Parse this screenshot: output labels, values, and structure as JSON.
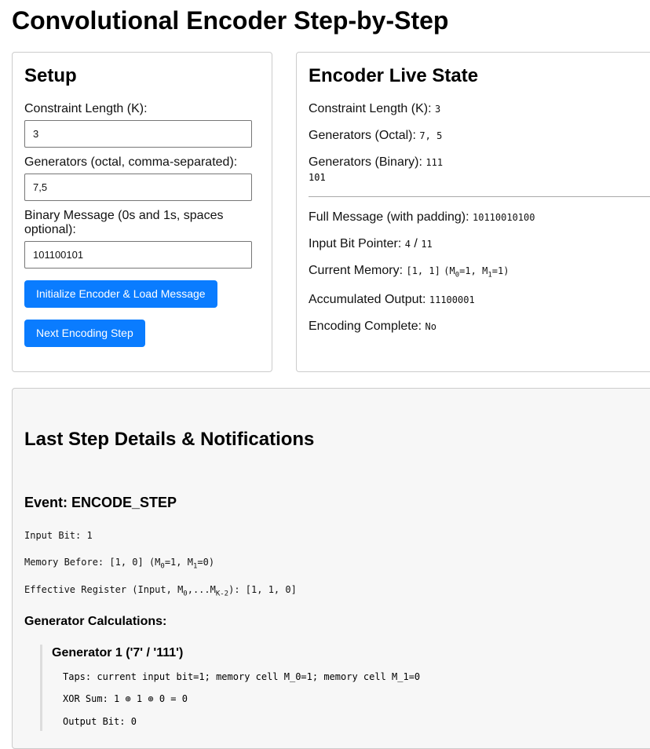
{
  "page": {
    "title": "Convolutional Encoder Step-by-Step"
  },
  "setup": {
    "heading": "Setup",
    "k_label": "Constraint Length (K):",
    "k_value": "3",
    "gen_label": "Generators (octal, comma-separated):",
    "gen_value": "7,5",
    "msg_label": "Binary Message (0s and 1s, spaces optional):",
    "msg_value": "101100101",
    "init_button": "Initialize Encoder & Load Message",
    "next_button": "Next Encoding Step"
  },
  "live": {
    "heading": "Encoder Live State",
    "k_label": "Constraint Length (K):",
    "k_value": "3",
    "gen_octal_label": "Generators (Octal):",
    "gen_octal_value": "7, 5",
    "gen_binary_label": "Generators (Binary):",
    "gen_binary_line1": "111",
    "gen_binary_line2": "101",
    "full_msg_label": "Full Message (with padding):",
    "full_msg_value": "10110010100",
    "pointer_label": "Input Bit Pointer:",
    "pointer_current": "4",
    "pointer_sep": " / ",
    "pointer_total": "11",
    "memory_label": "Current Memory:",
    "memory_value": "[1, 1]",
    "memory_m0": "1",
    "memory_m1": "1",
    "output_label": "Accumulated Output:",
    "output_value": "11100001",
    "complete_label": "Encoding Complete:",
    "complete_value": "No"
  },
  "details": {
    "heading": "Last Step Details & Notifications",
    "event_heading": "Event: ENCODE_STEP",
    "input_bit_text": "Input Bit: 1",
    "memory_before_prefix": "Memory Before: [1, 0] (M",
    "memory_before_m0": "1",
    "memory_before_m1": "0",
    "effective_prefix": "Effective Register (Input, M",
    "effective_value": "[1, 1, 0]",
    "gen_calc_heading": "Generator Calculations:",
    "gen1_heading": "Generator 1 ('7' / '111')",
    "gen1_taps": "Taps: current input bit=1; memory cell M_0=1; memory cell M_1=0",
    "gen1_xor": "XOR Sum: 1 ⊕ 1 ⊕ 0 = 0",
    "gen1_output": "Output Bit: 0"
  }
}
